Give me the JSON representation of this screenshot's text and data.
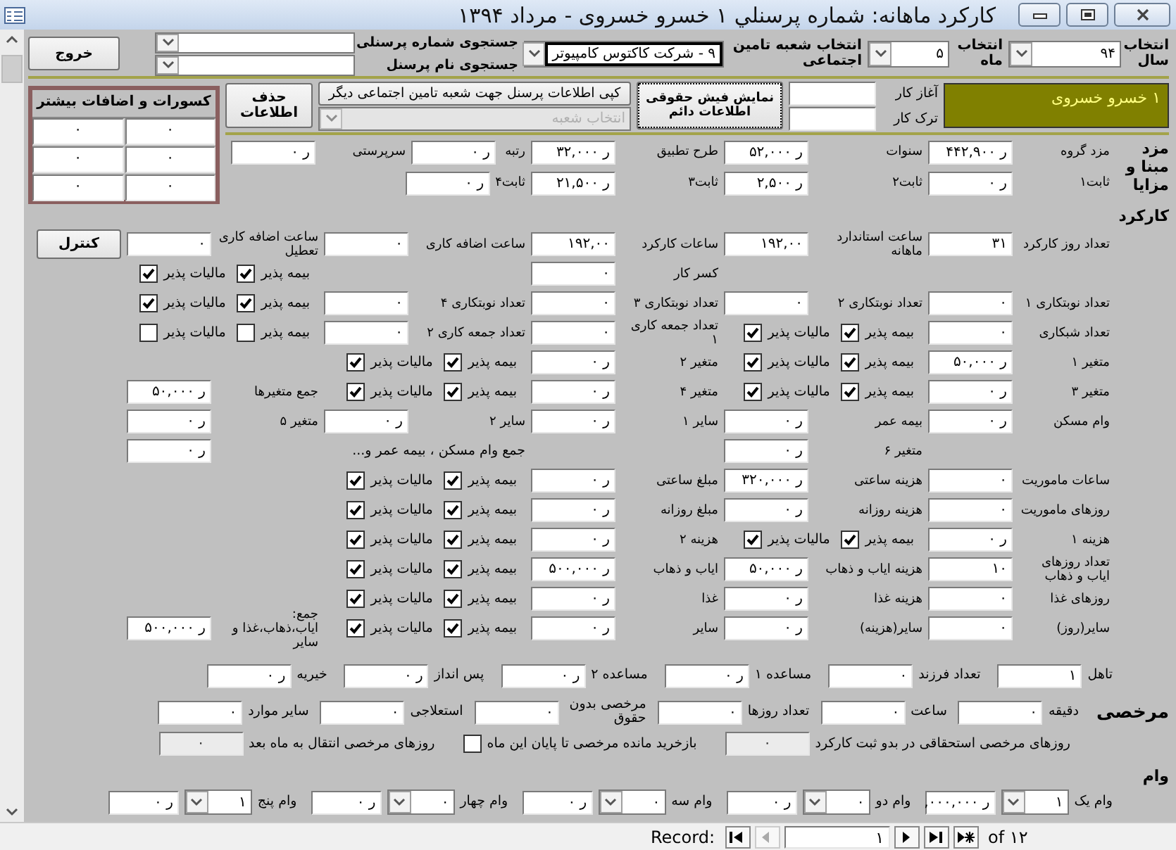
{
  "window": {
    "title": "کارکرد ماهانه: شماره پرسنلي ۱ خسرو خسروی  -  مرداد ۱۳۹۴"
  },
  "header": {
    "year": {
      "label": "انتخاب سال",
      "value": "۹۴"
    },
    "month": {
      "label": "انتخاب ماه",
      "value": "۵"
    },
    "branch": {
      "label": "انتخاب شعبه تامین اجتماعی",
      "value": "۹ - شرکت کاکتوس کامپیوتر"
    },
    "search": [
      {
        "label": "جستجوی شماره پرسنلی"
      },
      {
        "label": "جستجوی نام پرسنل"
      }
    ],
    "exit_button": "خروج"
  },
  "employee": {
    "name": "۱ خسرو خسروی",
    "dates": [
      {
        "label": "آغاز کار"
      },
      {
        "label": "ترک کار"
      }
    ]
  },
  "actions": {
    "payslip_button": "نمایش فیش حقوقی اطلاعات دائم",
    "copy_button": "کپی اطلاعات پرسنل جهت شعبه تامین اجتماعی دیگر",
    "branch_select": {
      "placeholder": "انتخاب شعبه",
      "disabled": true
    },
    "delete_button": "حذف اطلاعات"
  },
  "deductions": {
    "title": "کسورات و اضافات بیشتر",
    "cells": [
      "۰",
      "۰",
      "۰",
      "۰",
      "۰",
      "۰"
    ]
  },
  "wage": {
    "title": "مزد مبنا و مزایا",
    "rows": [
      [
        {
          "kind": "field",
          "label": "مزد گروه",
          "value": "ر ۴۴۲,۹۰۰"
        },
        {
          "kind": "field",
          "label": "سنوات",
          "value": "ر ۵۲,۰۰۰"
        },
        {
          "kind": "field",
          "label": "طرح تطبیق",
          "value": "ر ۳۲,۰۰۰"
        },
        {
          "kind": "field",
          "label": "رتبه",
          "value": "ر ۰"
        },
        {
          "kind": "field",
          "label": "سرپرستی",
          "value": "ر ۰"
        }
      ],
      [
        {
          "kind": "field",
          "label": "ثابت۱",
          "value": "ر ۰"
        },
        {
          "kind": "field",
          "label": "ثابت۲",
          "value": "ر ۲,۵۰۰"
        },
        {
          "kind": "field",
          "label": "ثابت۳",
          "value": "ر ۲۱,۵۰۰"
        },
        {
          "kind": "field",
          "label": "ثابت۴",
          "value": "ر ۰"
        },
        {
          "kind": "blank"
        }
      ]
    ]
  },
  "work": {
    "title": "کارکرد",
    "rows": [
      [
        {
          "kind": "field",
          "label": "تعداد روز کارکرد",
          "value": "۳۱"
        },
        {
          "kind": "field",
          "label": "ساعت استاندارد ماهانه",
          "value": "۱۹۲,۰۰"
        },
        {
          "kind": "field",
          "label": "ساعات کارکرد",
          "value": "۱۹۲,۰۰"
        },
        {
          "kind": "field",
          "label": "ساعت اضافه کاری",
          "value": "۰"
        },
        {
          "kind": "field",
          "label": "ساعت اضافه کاری تعطیل",
          "value": "۰"
        },
        {
          "kind": "button",
          "label": "کنترل"
        }
      ],
      [
        {
          "kind": "blank"
        },
        {
          "kind": "blank"
        },
        {
          "kind": "field",
          "label": "کسر کار",
          "value": "۰"
        },
        {
          "kind": "blank"
        },
        {
          "kind": "checks",
          "items": [
            {
              "label": "بیمه پذیر",
              "checked": true
            },
            {
              "label": "مالیات پذیر",
              "checked": true
            }
          ]
        },
        {
          "kind": "blank"
        }
      ],
      [
        {
          "kind": "field",
          "label": "تعداد نوبتکاری ۱",
          "value": "۰"
        },
        {
          "kind": "field",
          "label": "تعداد نوبتکاری ۲",
          "value": "۰"
        },
        {
          "kind": "field",
          "label": "تعداد نوبتکاری ۳",
          "value": "۰"
        },
        {
          "kind": "field",
          "label": "تعداد نوبتکاری ۴",
          "value": "۰"
        },
        {
          "kind": "checks",
          "items": [
            {
              "label": "بیمه پذیر",
              "checked": true
            },
            {
              "label": "مالیات پذیر",
              "checked": true
            }
          ]
        },
        {
          "kind": "blank"
        }
      ],
      [
        {
          "kind": "field",
          "label": "تعداد شبکاری",
          "value": "۰"
        },
        {
          "kind": "checks",
          "items": [
            {
              "label": "بیمه پذیر",
              "checked": true
            },
            {
              "label": "مالیات پذیر",
              "checked": true
            }
          ]
        },
        {
          "kind": "field",
          "label": "تعداد جمعه کاری ۱",
          "value": "۰"
        },
        {
          "kind": "field",
          "label": "تعداد جمعه کاری ۲",
          "value": "۰"
        },
        {
          "kind": "checks",
          "items": [
            {
              "label": "بیمه پذیر",
              "checked": false
            },
            {
              "label": "مالیات پذیر",
              "checked": false
            }
          ]
        },
        {
          "kind": "blank"
        }
      ],
      [
        {
          "kind": "field",
          "label": "متغیر ۱",
          "value": "ر ۵۰,۰۰۰"
        },
        {
          "kind": "checks",
          "items": [
            {
              "label": "بیمه پذیر",
              "checked": true
            },
            {
              "label": "مالیات پذیر",
              "checked": true
            }
          ]
        },
        {
          "kind": "field",
          "label": "متغیر ۲",
          "value": "ر ۰"
        },
        {
          "kind": "checks",
          "items": [
            {
              "label": "بیمه پذیر",
              "checked": true
            },
            {
              "label": "مالیات پذیر",
              "checked": true
            }
          ]
        },
        {
          "kind": "blank"
        },
        {
          "kind": "blank"
        }
      ],
      [
        {
          "kind": "field",
          "label": "متغیر ۳",
          "value": "ر ۰"
        },
        {
          "kind": "checks",
          "items": [
            {
              "label": "بیمه پذیر",
              "checked": true
            },
            {
              "label": "مالیات پذیر",
              "checked": true
            }
          ]
        },
        {
          "kind": "field",
          "label": "متغیر ۴",
          "value": "ر ۰"
        },
        {
          "kind": "checks",
          "items": [
            {
              "label": "بیمه پذیر",
              "checked": true
            },
            {
              "label": "مالیات پذیر",
              "checked": true
            }
          ]
        },
        {
          "kind": "field",
          "label": "جمع متغیرها",
          "value": "ر ۵۰,۰۰۰"
        },
        {
          "kind": "blank"
        }
      ],
      [
        {
          "kind": "field",
          "label": "وام مسکن",
          "value": "ر ۰"
        },
        {
          "kind": "field",
          "label": "بیمه عمر",
          "value": "ر ۰"
        },
        {
          "kind": "field",
          "label": "سایر ۱",
          "value": "ر ۰"
        },
        {
          "kind": "field",
          "label": "سایر ۲",
          "value": "ر ۰"
        },
        {
          "kind": "field",
          "label": "متغیر ۵",
          "value": "ر ۰"
        },
        {
          "kind": "blank"
        }
      ],
      [
        {
          "kind": "blank"
        },
        {
          "kind": "field",
          "label": "متغیر ۶",
          "value": "ر ۰"
        },
        {
          "kind": "blank"
        },
        {
          "kind": "caption",
          "text": "جمع وام مسکن ، بیمه عمر و..."
        },
        {
          "kind": "field",
          "value": "ر ۰"
        },
        {
          "kind": "blank"
        }
      ],
      [
        {
          "kind": "field",
          "label": "ساعات ماموریت",
          "value": "۰"
        },
        {
          "kind": "field",
          "label": "هزینه ساعتی",
          "value": "ر ۳۲۰,۰۰۰"
        },
        {
          "kind": "field",
          "label": "مبلغ ساعتی",
          "value": "ر ۰"
        },
        {
          "kind": "checks",
          "items": [
            {
              "label": "بیمه پذیر",
              "checked": true
            },
            {
              "label": "مالیات پذیر",
              "checked": true
            }
          ]
        },
        {
          "kind": "blank"
        },
        {
          "kind": "blank"
        }
      ],
      [
        {
          "kind": "field",
          "label": "روزهای ماموریت",
          "value": "۰"
        },
        {
          "kind": "field",
          "label": "هزینه روزانه",
          "value": "ر ۰"
        },
        {
          "kind": "field",
          "label": "مبلغ روزانه",
          "value": "ر ۰"
        },
        {
          "kind": "checks",
          "items": [
            {
              "label": "بیمه پذیر",
              "checked": true
            },
            {
              "label": "مالیات پذیر",
              "checked": true
            }
          ]
        },
        {
          "kind": "blank"
        },
        {
          "kind": "blank"
        }
      ],
      [
        {
          "kind": "field",
          "label": "هزینه ۱",
          "value": "ر ۰"
        },
        {
          "kind": "checks",
          "items": [
            {
              "label": "بیمه پذیر",
              "checked": true
            },
            {
              "label": "مالیات پذیر",
              "checked": true
            }
          ]
        },
        {
          "kind": "field",
          "label": "هزینه ۲",
          "value": "ر ۰"
        },
        {
          "kind": "checks",
          "items": [
            {
              "label": "بیمه پذیر",
              "checked": true
            },
            {
              "label": "مالیات پذیر",
              "checked": true
            }
          ]
        },
        {
          "kind": "blank"
        },
        {
          "kind": "blank"
        }
      ],
      [
        {
          "kind": "field",
          "label": "تعداد روزهای ایاب و ذهاب",
          "value": "۱۰"
        },
        {
          "kind": "field",
          "label": "هزینه ایاب و ذهاب",
          "value": "ر ۵۰,۰۰۰"
        },
        {
          "kind": "field",
          "label": "ایاب و ذهاب",
          "value": "ر ۵۰۰,۰۰۰"
        },
        {
          "kind": "checks",
          "items": [
            {
              "label": "بیمه پذیر",
              "checked": true
            },
            {
              "label": "مالیات پذیر",
              "checked": true
            }
          ]
        },
        {
          "kind": "blank"
        },
        {
          "kind": "blank"
        }
      ],
      [
        {
          "kind": "field",
          "label": "روزهای غذا",
          "value": "۰"
        },
        {
          "kind": "field",
          "label": "هزینه غذا",
          "value": "ر ۰"
        },
        {
          "kind": "field",
          "label": "غذا",
          "value": "ر ۰"
        },
        {
          "kind": "checks",
          "items": [
            {
              "label": "بیمه پذیر",
              "checked": true
            },
            {
              "label": "مالیات پذیر",
              "checked": true
            }
          ]
        },
        {
          "kind": "blank"
        },
        {
          "kind": "blank"
        }
      ],
      [
        {
          "kind": "field",
          "label": "سایر(روز)",
          "value": "۰"
        },
        {
          "kind": "field",
          "label": "سایر(هزینه)",
          "value": "ر ۰"
        },
        {
          "kind": "field",
          "label": "سایر",
          "value": "ر ۰"
        },
        {
          "kind": "checks",
          "items": [
            {
              "label": "بیمه پذیر",
              "checked": true
            },
            {
              "label": "مالیات پذیر",
              "checked": true
            }
          ]
        },
        {
          "kind": "field",
          "label": "جمع: ایاب،ذهاب،غذا و سایر",
          "value": "ر ۵۰۰,۰۰۰"
        },
        {
          "kind": "blank"
        }
      ]
    ]
  },
  "family": [
    {
      "label": "تاهل",
      "value": "۱"
    },
    {
      "label": "تعداد فرزند",
      "value": "۰"
    },
    {
      "label": "مساعده ۱",
      "value": "ر ۰"
    },
    {
      "label": "مساعده ۲",
      "value": "ر ۰"
    },
    {
      "label": "پس انداز",
      "value": "ر ۰"
    },
    {
      "label": "خیریه",
      "value": "ر ۰"
    }
  ],
  "leave": {
    "title": "مرخصی",
    "fields": [
      {
        "label": "دقیقه",
        "value": "۰"
      },
      {
        "label": "ساعت",
        "value": "۰"
      },
      {
        "label": "تعداد روزها",
        "value": "۰"
      },
      {
        "label": "مرخصی بدون حقوق",
        "value": "۰"
      },
      {
        "label": "استعلاجی",
        "value": "۰"
      },
      {
        "label": "سایر موارد",
        "value": "۰"
      }
    ],
    "entitled": {
      "label": "روزهای مرخصی استحقاقی در بدو ثبت کارکرد",
      "value": "۰",
      "disabled": true
    },
    "buyback": {
      "label": "بازخرید مانده مرخصی تا پایان این ماه",
      "checked": false
    },
    "carryover": {
      "label": "روزهای مرخصی انتقال به ماه بعد",
      "value": "۰",
      "disabled": true
    }
  },
  "loans": {
    "title": "وام",
    "items": [
      {
        "label": "وام یک",
        "number": "۱",
        "amount": "ر ۰۰۰,۰۰۰,"
      },
      {
        "label": "وام دو",
        "number": "۰",
        "amount": "ر ۰"
      },
      {
        "label": "وام سه",
        "number": "۰",
        "amount": "ر ۰"
      },
      {
        "label": "وام چهار",
        "number": "۰",
        "amount": "ر ۰"
      },
      {
        "label": "وام پنج",
        "number": "۱",
        "amount": "ر ۰"
      }
    ]
  },
  "record_nav": {
    "label": "Record:",
    "current": "۱",
    "total": "of ۱۲",
    "buttons": [
      {
        "kind": "first",
        "disabled": false
      },
      {
        "kind": "prev",
        "disabled": true
      },
      {
        "kind": "next",
        "disabled": false
      },
      {
        "kind": "last",
        "disabled": false
      },
      {
        "kind": "new",
        "disabled": false
      }
    ]
  }
}
